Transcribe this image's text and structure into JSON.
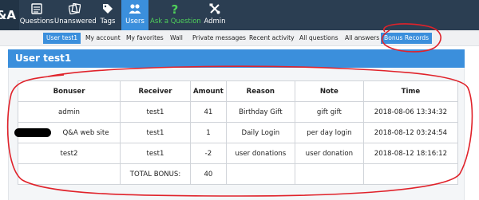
{
  "logo": {
    "text": "&A"
  },
  "nav": {
    "items": [
      {
        "label": "Questions",
        "icon": "questions-icon"
      },
      {
        "label": "Unanswered",
        "icon": "unanswered-icon"
      },
      {
        "label": "Tags",
        "icon": "tags-icon"
      },
      {
        "label": "Users",
        "icon": "users-icon",
        "active": true
      },
      {
        "label": "Ask a Question",
        "icon": "ask-question-icon",
        "color": "#4fd05a"
      },
      {
        "label": "Admin",
        "icon": "admin-icon"
      }
    ]
  },
  "subnav": {
    "items": [
      {
        "label": "User test1",
        "active": true
      },
      {
        "label": "My account"
      },
      {
        "label": "My favorites"
      },
      {
        "label": "Wall"
      },
      {
        "label": "Private messages"
      },
      {
        "label": "Recent activity"
      },
      {
        "label": "All questions"
      },
      {
        "label": "All answers"
      },
      {
        "label": "Bonus Records",
        "highlighted": true
      }
    ]
  },
  "page": {
    "title": "User test1"
  },
  "table": {
    "headers": [
      "Bonuser",
      "Receiver",
      "Amount",
      "Reason",
      "Note",
      "Time"
    ],
    "rows": [
      [
        "admin",
        "test1",
        "41",
        "Birthday Gift",
        "gift gift",
        "2018-08-06 13:34:32"
      ],
      [
        "Q&A web site",
        "test1",
        "1",
        "Daily Login",
        "per day login",
        "2018-08-12 03:24:54"
      ],
      [
        "test2",
        "test1",
        "-2",
        "user donations",
        "user donation",
        "2018-08-12 18:16:12"
      ]
    ],
    "total_label": "TOTAL BONUS:",
    "total_value": "40"
  },
  "colors": {
    "topbar": "#2b3e52",
    "accent": "#3b8fdc",
    "ask_green": "#4fd05a",
    "annotation_red": "#e0222a"
  }
}
